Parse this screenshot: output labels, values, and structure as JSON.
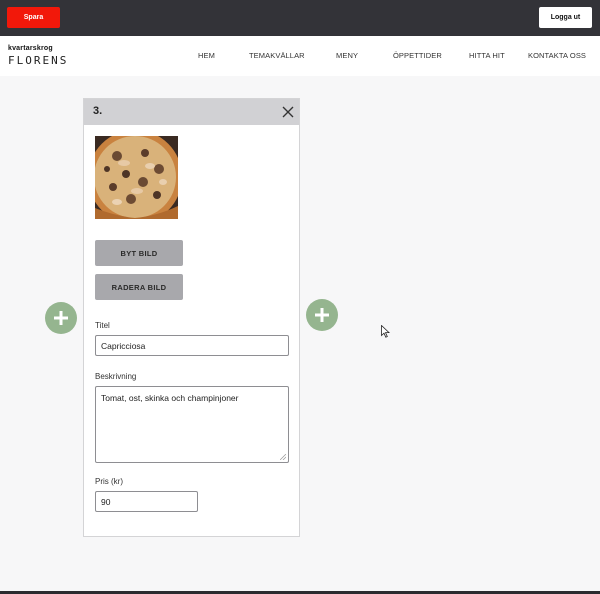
{
  "topbar": {
    "save_label": "Spara",
    "logout_label": "Logga ut",
    "colors": {
      "background": "#333338",
      "save": "#f2180a",
      "logout": "#ffffff"
    }
  },
  "logo": {
    "line1": "kvartarskrog",
    "line2": "FLORENS"
  },
  "nav": {
    "items": [
      {
        "label": "HEM"
      },
      {
        "label": "TEMAKVÄLLAR"
      },
      {
        "label": "MENY"
      },
      {
        "label": "ÖPPETTIDER"
      },
      {
        "label": "HITTA HIT"
      },
      {
        "label": "KONTAKTA OSS"
      }
    ]
  },
  "card": {
    "number": "3.",
    "close_icon": "close-icon",
    "image_icon": "pizza-photo",
    "buttons": {
      "change_image": "BYT BILD",
      "delete_image": "RADERA BILD"
    },
    "fields": {
      "title_label": "Titel",
      "title_value": "Capricciosa",
      "description_label": "Beskrivning",
      "description_value": "Tomat, ost, skinka och champinjoner",
      "price_label": "Pris (kr)",
      "price_value": "90"
    }
  },
  "add_buttons": {
    "icon": "plus-icon",
    "color": "#95b58f"
  }
}
